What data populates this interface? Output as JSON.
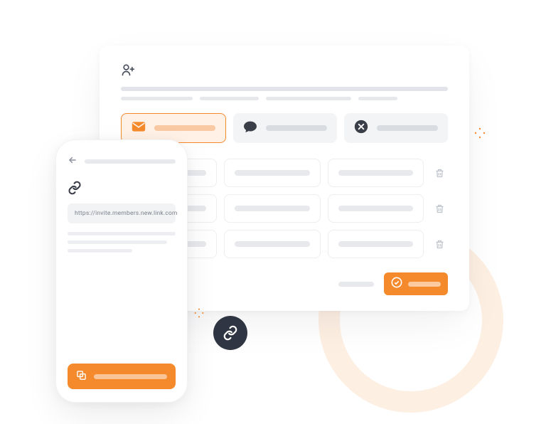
{
  "colors": {
    "accent": "#F58A2C",
    "dark": "#2F3542",
    "muted": "#e7e9ed"
  },
  "desktop": {
    "chips": [
      {
        "icon": "envelope-icon",
        "active": true
      },
      {
        "icon": "chat-bubble-icon",
        "active": false
      },
      {
        "icon": "close-circle-icon",
        "active": false
      }
    ],
    "grid_rows": 3,
    "grid_cols": 3,
    "primary_button": "confirm"
  },
  "phone": {
    "url": "https://invite.members.new.link.com",
    "action": "copy"
  }
}
